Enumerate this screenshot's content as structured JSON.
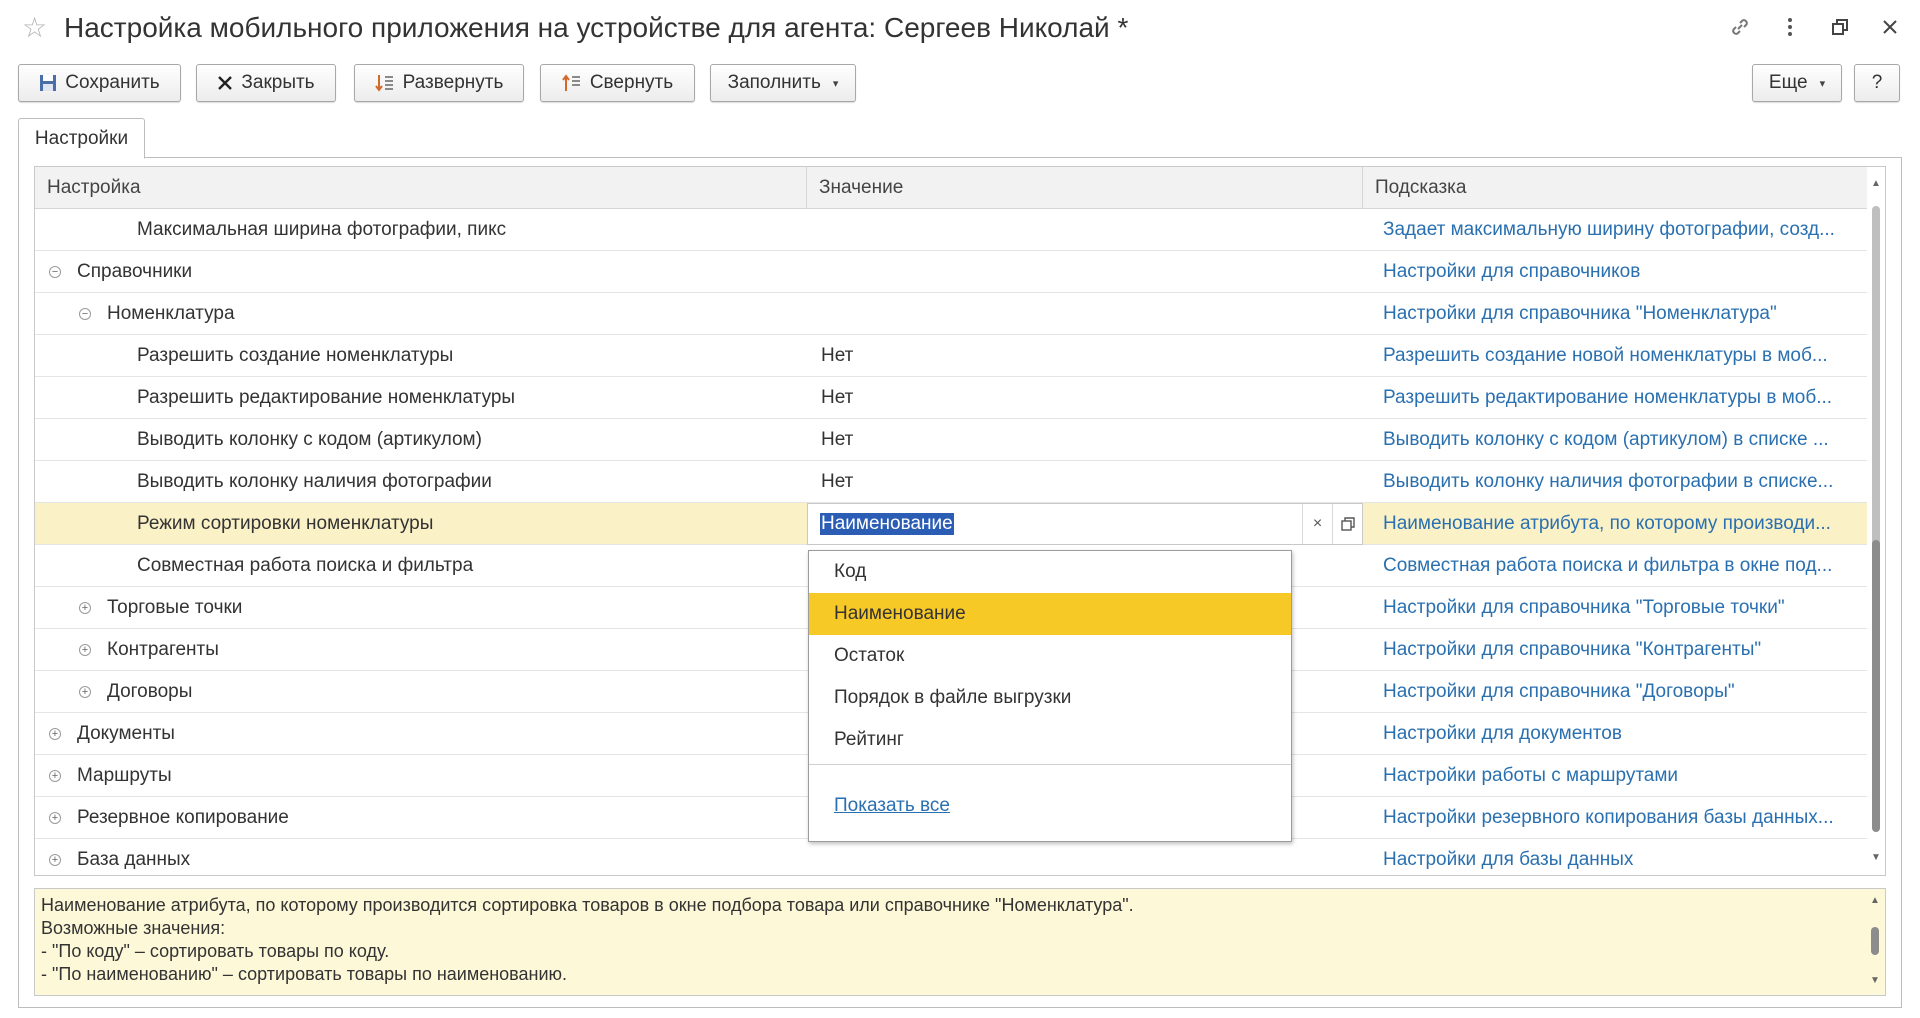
{
  "window": {
    "title": "Настройка мобильного приложения на устройстве для агента: Сергеев Николай *",
    "icons": [
      "star-icon",
      "link-icon",
      "more-icon",
      "restore-icon",
      "close-icon"
    ]
  },
  "toolbar": {
    "save_label": "Сохранить",
    "close_label": "Закрыть",
    "expand_label": "Развернуть",
    "collapse_label": "Свернуть",
    "fill_label": "Заполнить",
    "more_label": "Еще",
    "help_label": "?"
  },
  "tabs": [
    {
      "label": "Настройки"
    }
  ],
  "grid": {
    "columns": {
      "name": "Настройка",
      "value": "Значение",
      "hint": "Подсказка"
    },
    "rows": [
      {
        "name": "Максимальная ширина фотографии, пикс",
        "value": "",
        "hint": "Задает максимальную ширину фотографии, созд..."
      },
      {
        "name": "Справочники",
        "value": "",
        "hint": "Настройки для справочников"
      },
      {
        "name": "Номенклатура",
        "value": "",
        "hint": "Настройки для справочника \"Номенклатура\""
      },
      {
        "name": "Разрешить создание номенклатуры",
        "value": "Нет",
        "hint": "Разрешить создание новой номенклатуры в моб..."
      },
      {
        "name": "Разрешить редактирование номенклатуры",
        "value": "Нет",
        "hint": "Разрешить редактирование номенклатуры в моб..."
      },
      {
        "name": "Выводить колонку с кодом (артикулом)",
        "value": "Нет",
        "hint": "Выводить колонку с кодом (артикулом) в списке ..."
      },
      {
        "name": "Выводить колонку наличия фотографии",
        "value": "Нет",
        "hint": "Выводить колонку наличия фотографии в списке..."
      },
      {
        "name": "Режим сортировки номенклатуры",
        "value": "Наименование",
        "hint": "Наименование атрибута, по которому производи..."
      },
      {
        "name": "Совместная работа поиска и фильтра",
        "value": "",
        "hint": "Совместная работа поиска и фильтра в окне под..."
      },
      {
        "name": "Торговые точки",
        "value": "",
        "hint": "Настройки для справочника \"Торговые точки\""
      },
      {
        "name": "Контрагенты",
        "value": "",
        "hint": "Настройки для справочника \"Контрагенты\""
      },
      {
        "name": "Договоры",
        "value": "",
        "hint": "Настройки для справочника \"Договоры\""
      },
      {
        "name": "Документы",
        "value": "",
        "hint": "Настройки для документов"
      },
      {
        "name": "Маршруты",
        "value": "",
        "hint": "Настройки работы с маршрутами"
      },
      {
        "name": "Резервное копирование",
        "value": "",
        "hint": "Настройки резервного копирования базы данных..."
      },
      {
        "name": "База данных",
        "value": "",
        "hint": "Настройки для базы данных"
      }
    ]
  },
  "dropdown": {
    "options": [
      "Код",
      "Наименование",
      "Остаток",
      "Порядок в файле выгрузки",
      "Рейтинг"
    ],
    "selected": "Наименование",
    "show_all": "Показать все"
  },
  "description": {
    "lines": [
      "Наименование атрибута, по которому производится сортировка товаров в окне подбора товара или справочнике \"Номенклатура\".",
      "Возможные значения:",
      "- \"По коду\" – сортировать товары по коду.",
      "- \"По наименованию\" – сортировать товары по наименованию."
    ]
  },
  "colors": {
    "accent_yellow": "#f7c926",
    "selected_row": "#fbf1c7",
    "link_blue": "#2a70b0",
    "description_bg": "#fdf8d8"
  }
}
